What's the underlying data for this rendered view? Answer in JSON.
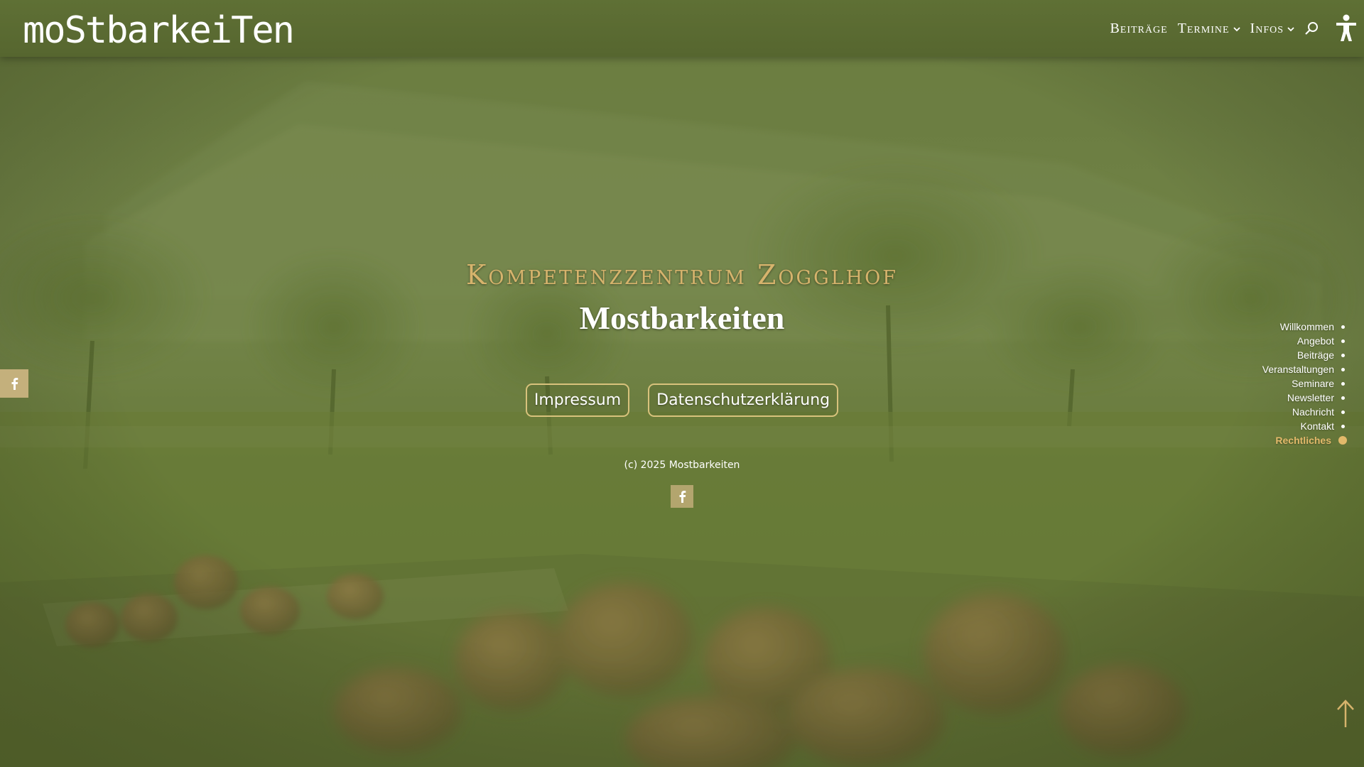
{
  "header": {
    "logo_text": "moStbarkeiTen",
    "nav": [
      {
        "label": "Beiträge",
        "has_dropdown": false
      },
      {
        "label": "Termine",
        "has_dropdown": true
      },
      {
        "label": "Infos",
        "has_dropdown": true
      }
    ],
    "search_icon": "search-icon",
    "accessibility_icon": "accessibility-icon"
  },
  "hero": {
    "kicker": "Kompetenzzentrum Zogglhof",
    "title": "Mostbarkeiten",
    "buttons": [
      {
        "label": "Impressum"
      },
      {
        "label": "Datenschutzerklärung"
      }
    ],
    "copyright": "(c) 2025 Mostbarkeiten",
    "social_icon": "facebook-icon"
  },
  "side_social": {
    "icon": "facebook-icon"
  },
  "dotnav": {
    "items": [
      {
        "label": "Willkommen",
        "active": false
      },
      {
        "label": "Angebot",
        "active": false
      },
      {
        "label": "Beiträge",
        "active": false
      },
      {
        "label": "Veranstaltungen",
        "active": false
      },
      {
        "label": "Seminare",
        "active": false
      },
      {
        "label": "Newsletter",
        "active": false
      },
      {
        "label": "Nachricht",
        "active": false
      },
      {
        "label": "Kontakt",
        "active": false
      },
      {
        "label": "Rechtliches",
        "active": true
      }
    ]
  },
  "back_to_top_icon": "arrow-up-icon",
  "colors": {
    "overlay_green": "#66783b",
    "header_green": "#5a6b32",
    "gold_accent": "#d6b36c",
    "button_border": "#d8c27c",
    "facebook_box": "#b3a56e"
  }
}
